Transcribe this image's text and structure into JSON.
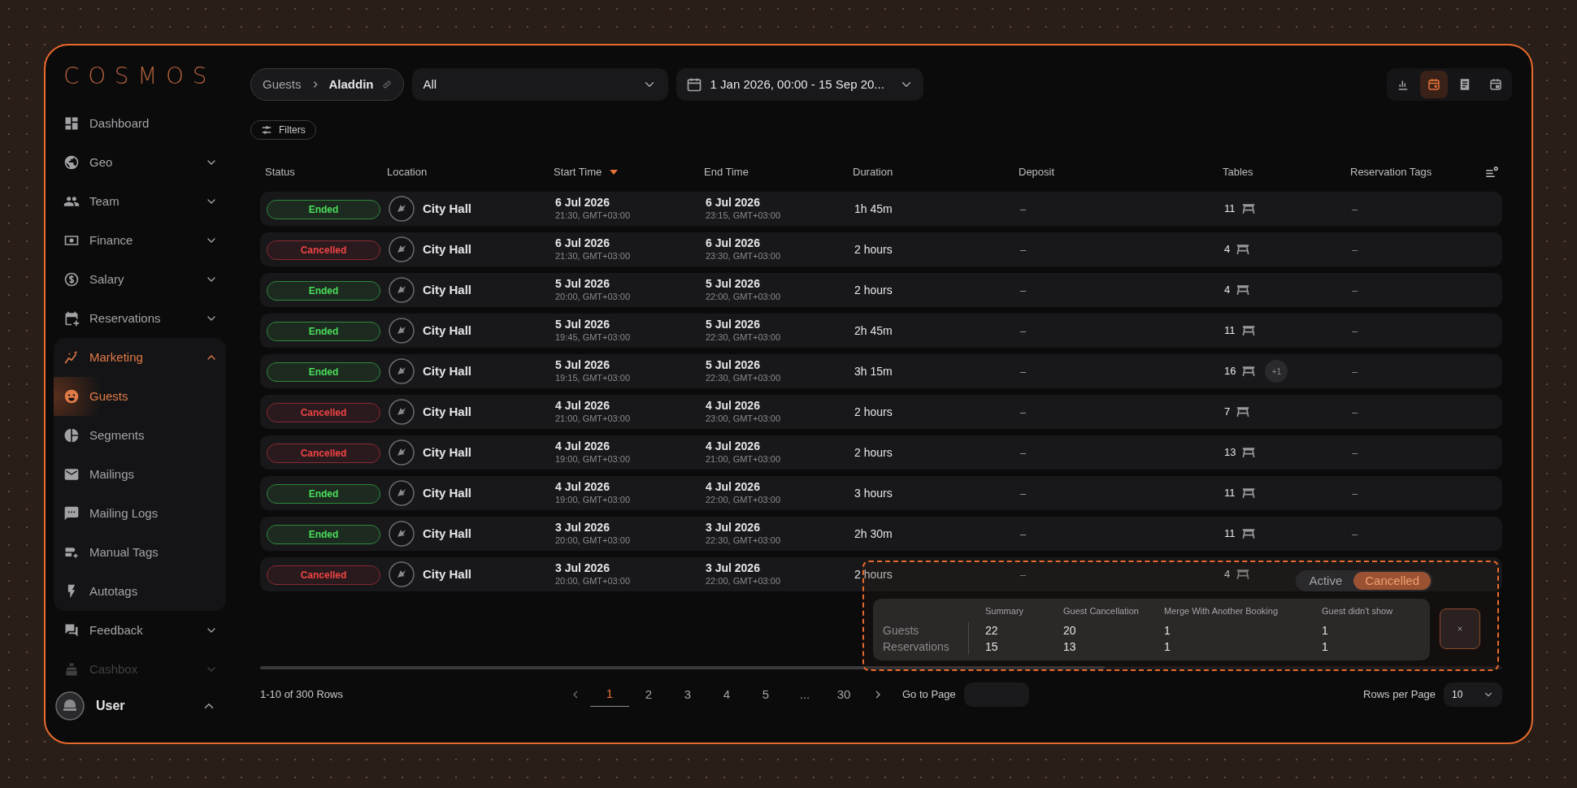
{
  "brand": "COSMOS",
  "sidebar": {
    "items": [
      {
        "label": "Dashboard",
        "kind": "link",
        "selected": false,
        "disabled": false
      },
      {
        "label": "Geo",
        "kind": "group",
        "expanded": false,
        "selected": false,
        "disabled": false
      },
      {
        "label": "Team",
        "kind": "group",
        "expanded": false,
        "selected": false,
        "disabled": false
      },
      {
        "label": "Finance",
        "kind": "group",
        "expanded": false,
        "selected": false,
        "disabled": false
      },
      {
        "label": "Salary",
        "kind": "group",
        "expanded": false,
        "selected": false,
        "disabled": false
      },
      {
        "label": "Reservations",
        "kind": "group",
        "expanded": false,
        "selected": false,
        "disabled": false
      },
      {
        "label": "Marketing",
        "kind": "group",
        "expanded": true,
        "selected": true,
        "disabled": false,
        "children": [
          {
            "label": "Guests",
            "selected": true
          },
          {
            "label": "Segments",
            "selected": false
          },
          {
            "label": "Mailings",
            "selected": false
          },
          {
            "label": "Mailing Logs",
            "selected": false
          },
          {
            "label": "Manual Tags",
            "selected": false
          },
          {
            "label": "Autotags",
            "selected": false
          }
        ]
      },
      {
        "label": "Feedback",
        "kind": "group",
        "expanded": false,
        "selected": false,
        "disabled": false
      },
      {
        "label": "Cashbox",
        "kind": "group",
        "expanded": false,
        "selected": false,
        "disabled": true
      }
    ],
    "user": {
      "name": "User",
      "expanded": true
    }
  },
  "breadcrumb": [
    "Guests",
    "Aladdin"
  ],
  "select": {
    "value": "All"
  },
  "date_range": "1 Jan 2026, 00:00 - 15 Sep 20...",
  "view_buttons": [
    {
      "selected": false
    },
    {
      "selected": true
    },
    {
      "selected": false
    },
    {
      "selected": false
    }
  ],
  "filters_button": "Filters",
  "table": {
    "columns": [
      {
        "label": "Status",
        "sorted": false
      },
      {
        "label": "Location",
        "sorted": false
      },
      {
        "label": "Start Time",
        "sorted": true
      },
      {
        "label": "End Time",
        "sorted": false
      },
      {
        "label": "Duration",
        "sorted": false
      },
      {
        "label": "Deposit",
        "sorted": false
      },
      {
        "label": "Tables",
        "sorted": false
      },
      {
        "label": "Reservation Tags",
        "sorted": false
      }
    ],
    "rows": [
      {
        "status": {
          "text": "Ended",
          "kind": "ended"
        },
        "location": "City Hall",
        "start_date": "6 Jul 2026",
        "start_time": "21:30, GMT+03:00",
        "end_date": "6 Jul 2026",
        "end_time": "23:15, GMT+03:00",
        "duration": "1h 45m",
        "deposit": "–",
        "tables": "11",
        "tags": "–"
      },
      {
        "status": {
          "text": "Cancelled",
          "kind": "cancelled"
        },
        "location": "City Hall",
        "start_date": "6 Jul 2026",
        "start_time": "21:30, GMT+03:00",
        "end_date": "6 Jul 2026",
        "end_time": "23:30, GMT+03:00",
        "duration": "2 hours",
        "deposit": "–",
        "tables": "4",
        "tags": "–"
      },
      {
        "status": {
          "text": "Ended",
          "kind": "ended"
        },
        "location": "City Hall",
        "start_date": "5 Jul 2026",
        "start_time": "20:00, GMT+03:00",
        "end_date": "5 Jul 2026",
        "end_time": "22:00, GMT+03:00",
        "duration": "2 hours",
        "deposit": "–",
        "tables": "4",
        "tags": "–"
      },
      {
        "status": {
          "text": "Ended",
          "kind": "ended"
        },
        "location": "City Hall",
        "start_date": "5 Jul 2026",
        "start_time": "19:45, GMT+03:00",
        "end_date": "5 Jul 2026",
        "end_time": "22:30, GMT+03:00",
        "duration": "2h 45m",
        "deposit": "–",
        "tables": "11",
        "tags": "–"
      },
      {
        "status": {
          "text": "Ended",
          "kind": "ended"
        },
        "location": "City Hall",
        "start_date": "5 Jul 2026",
        "start_time": "19:15, GMT+03:00",
        "end_date": "5 Jul 2026",
        "end_time": "22:30, GMT+03:00",
        "duration": "3h 15m",
        "deposit": "–",
        "tables": "16",
        "extra": "+1",
        "tags": "–"
      },
      {
        "status": {
          "text": "Cancelled",
          "kind": "cancelled"
        },
        "location": "City Hall",
        "start_date": "4 Jul 2026",
        "start_time": "21:00, GMT+03:00",
        "end_date": "4 Jul 2026",
        "end_time": "23:00, GMT+03:00",
        "duration": "2 hours",
        "deposit": "–",
        "tables": "7",
        "tags": "–"
      },
      {
        "status": {
          "text": "Cancelled",
          "kind": "cancelled"
        },
        "location": "City Hall",
        "start_date": "4 Jul 2026",
        "start_time": "19:00, GMT+03:00",
        "end_date": "4 Jul 2026",
        "end_time": "21:00, GMT+03:00",
        "duration": "2 hours",
        "deposit": "–",
        "tables": "13",
        "tags": "–"
      },
      {
        "status": {
          "text": "Ended",
          "kind": "ended"
        },
        "location": "City Hall",
        "start_date": "4 Jul 2026",
        "start_time": "19:00, GMT+03:00",
        "end_date": "4 Jul 2026",
        "end_time": "22:00, GMT+03:00",
        "duration": "3 hours",
        "deposit": "–",
        "tables": "11",
        "tags": "–"
      },
      {
        "status": {
          "text": "Ended",
          "kind": "ended"
        },
        "location": "City Hall",
        "start_date": "3 Jul 2026",
        "start_time": "20:00, GMT+03:00",
        "end_date": "3 Jul 2026",
        "end_time": "22:30, GMT+03:00",
        "duration": "2h 30m",
        "deposit": "–",
        "tables": "11",
        "tags": "–"
      },
      {
        "status": {
          "text": "Cancelled",
          "kind": "cancelled"
        },
        "location": "City Hall",
        "start_date": "3 Jul 2026",
        "start_time": "20:00, GMT+03:00",
        "end_date": "3 Jul 2026",
        "end_time": "22:00, GMT+03:00",
        "duration": "2 hours",
        "deposit": "–",
        "tables": "4"
      }
    ]
  },
  "summary_popup": {
    "toggle": [
      {
        "label": "Active",
        "selected": false
      },
      {
        "label": "Cancelled",
        "selected": true
      }
    ],
    "columns": [
      "Summary",
      "Guest Cancellation",
      "Merge With Another Booking",
      "Guest didn't show"
    ],
    "rows": [
      {
        "label": "Guests",
        "values": [
          "22",
          "20",
          "1",
          "1"
        ]
      },
      {
        "label": "Reservations",
        "values": [
          "15",
          "13",
          "1",
          "1"
        ]
      }
    ]
  },
  "pagination": {
    "range": "1-10 of 300 Rows",
    "pages": [
      {
        "label": "1",
        "selected": true
      },
      {
        "label": "2",
        "selected": false
      },
      {
        "label": "3",
        "selected": false
      },
      {
        "label": "4",
        "selected": false
      },
      {
        "label": "5",
        "selected": false
      },
      {
        "label": "...",
        "selected": false
      },
      {
        "label": "30",
        "selected": false
      }
    ],
    "go_to_label": "Go to Page",
    "rows_per_page_label": "Rows per Page",
    "rows_per_page": "10"
  }
}
